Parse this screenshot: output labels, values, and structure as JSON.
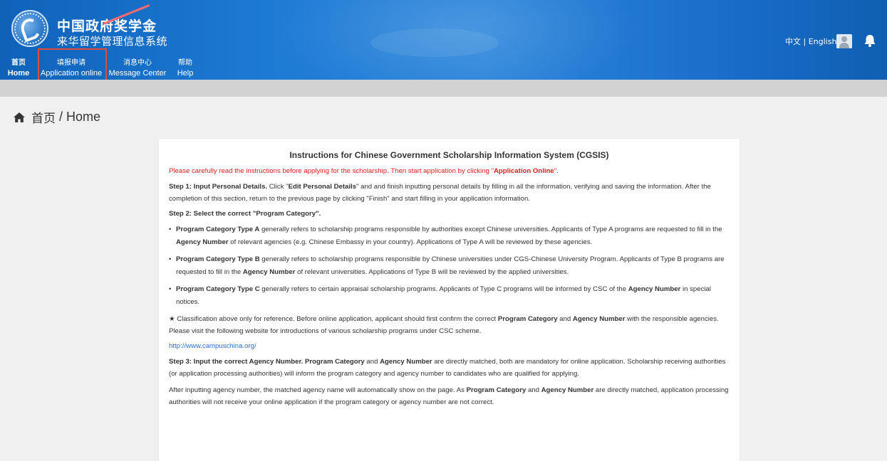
{
  "header": {
    "title_cn_line1": "中国政府奖学金",
    "title_cn_line2": "来华留学管理信息系统",
    "lang_switch": "中文 | English",
    "nav": [
      {
        "cn": "首页",
        "en": "Home"
      },
      {
        "cn": "填报申请",
        "en": "Application online"
      },
      {
        "cn": "消息中心",
        "en": "Message Center"
      },
      {
        "cn": "帮助",
        "en": "Help"
      }
    ]
  },
  "breadcrumb": {
    "cn": "首页",
    "sep": " / ",
    "en": "Home"
  },
  "instructions": {
    "title": "Instructions for Chinese Government Scholarship Information System (CGSIS)",
    "notice_pre": "Please carefully read the instructions before applying for the scholarship. Then start application by clicking \"",
    "notice_bold": "Application Online",
    "notice_post": "\".",
    "step1_head": "Step 1: Input Personal Details.",
    "step1_a": " Click \"",
    "step1_bold": "Edit Personal Details",
    "step1_b": "\" and and finish inputting personal details by filling in all the information, verifying and saving the information. After the completion of this section, return to the previous page by clicking \"Finish\" and start filling in your application information.",
    "step2_head": "Step 2: Select the correct \"Program Category\".",
    "typeA_bold": "Program Category Type A",
    "typeA_a": " generally refers to scholarship programs responsible by authorities except Chinese universities. Applicants of Type A programs are requested to fill in the ",
    "typeA_bold2": "Agency Number",
    "typeA_b": " of relevant agencies (e.g. Chinese Embassy in your country). Applications of Type A will be reviewed by these agencies.",
    "typeB_bold": "Program Category Type B",
    "typeB_a": " generally refers to scholarship programs responsible by Chinese universities under CGS-Chinese University Program. Applicants of Type B programs are requested to fill in the ",
    "typeB_bold2": "Agency Number",
    "typeB_b": " of relevant universities. Applications of Type B will be reviewed by the applied universities.",
    "typeC_bold": "Program Category Type C",
    "typeC_a": " generally refers to certain appraisal scholarship programs. Applicants of Type C programs will be informed by CSC of the ",
    "typeC_bold2": "Agency Number",
    "typeC_b": " in special notices.",
    "note_a": "★ Classification above only for reference. Before online application, applicant should first confirm the correct ",
    "note_bold1": "Program Category",
    "note_b": " and ",
    "note_bold2": "Agency Number",
    "note_c": " with the responsible agencies. Please visit the following website for introductions of various scholarship programs under CSC scheme.",
    "link": "http://www.campuschina.org/",
    "step3_head": "Step 3: Input the correct Agency Number. Program Category",
    "step3_a": " and ",
    "step3_bold": "Agency Number",
    "step3_b": " are directly matched, both are mandatory for online application. Scholarship receiving authorities (or application processing authorities) will inform the program category and agency number to candidates who are qualified for applying.",
    "after_a": "After inputting agency number, the matched agency name will automatically show on the page. As ",
    "after_bold1": "Program Category",
    "after_b": " and ",
    "after_bold2": "Agency Number",
    "after_c": " are directly matched, application processing authorities will not receive your online application if the program category or agency number are not correct."
  },
  "colors": {
    "header": "#1d7ad4",
    "accent_red": "#e01b1b",
    "highlight": "#e24a3c",
    "link": "#2a6fc9"
  },
  "icons": [
    "logo-emblem",
    "user-avatar-icon",
    "bell-icon",
    "home-icon"
  ]
}
